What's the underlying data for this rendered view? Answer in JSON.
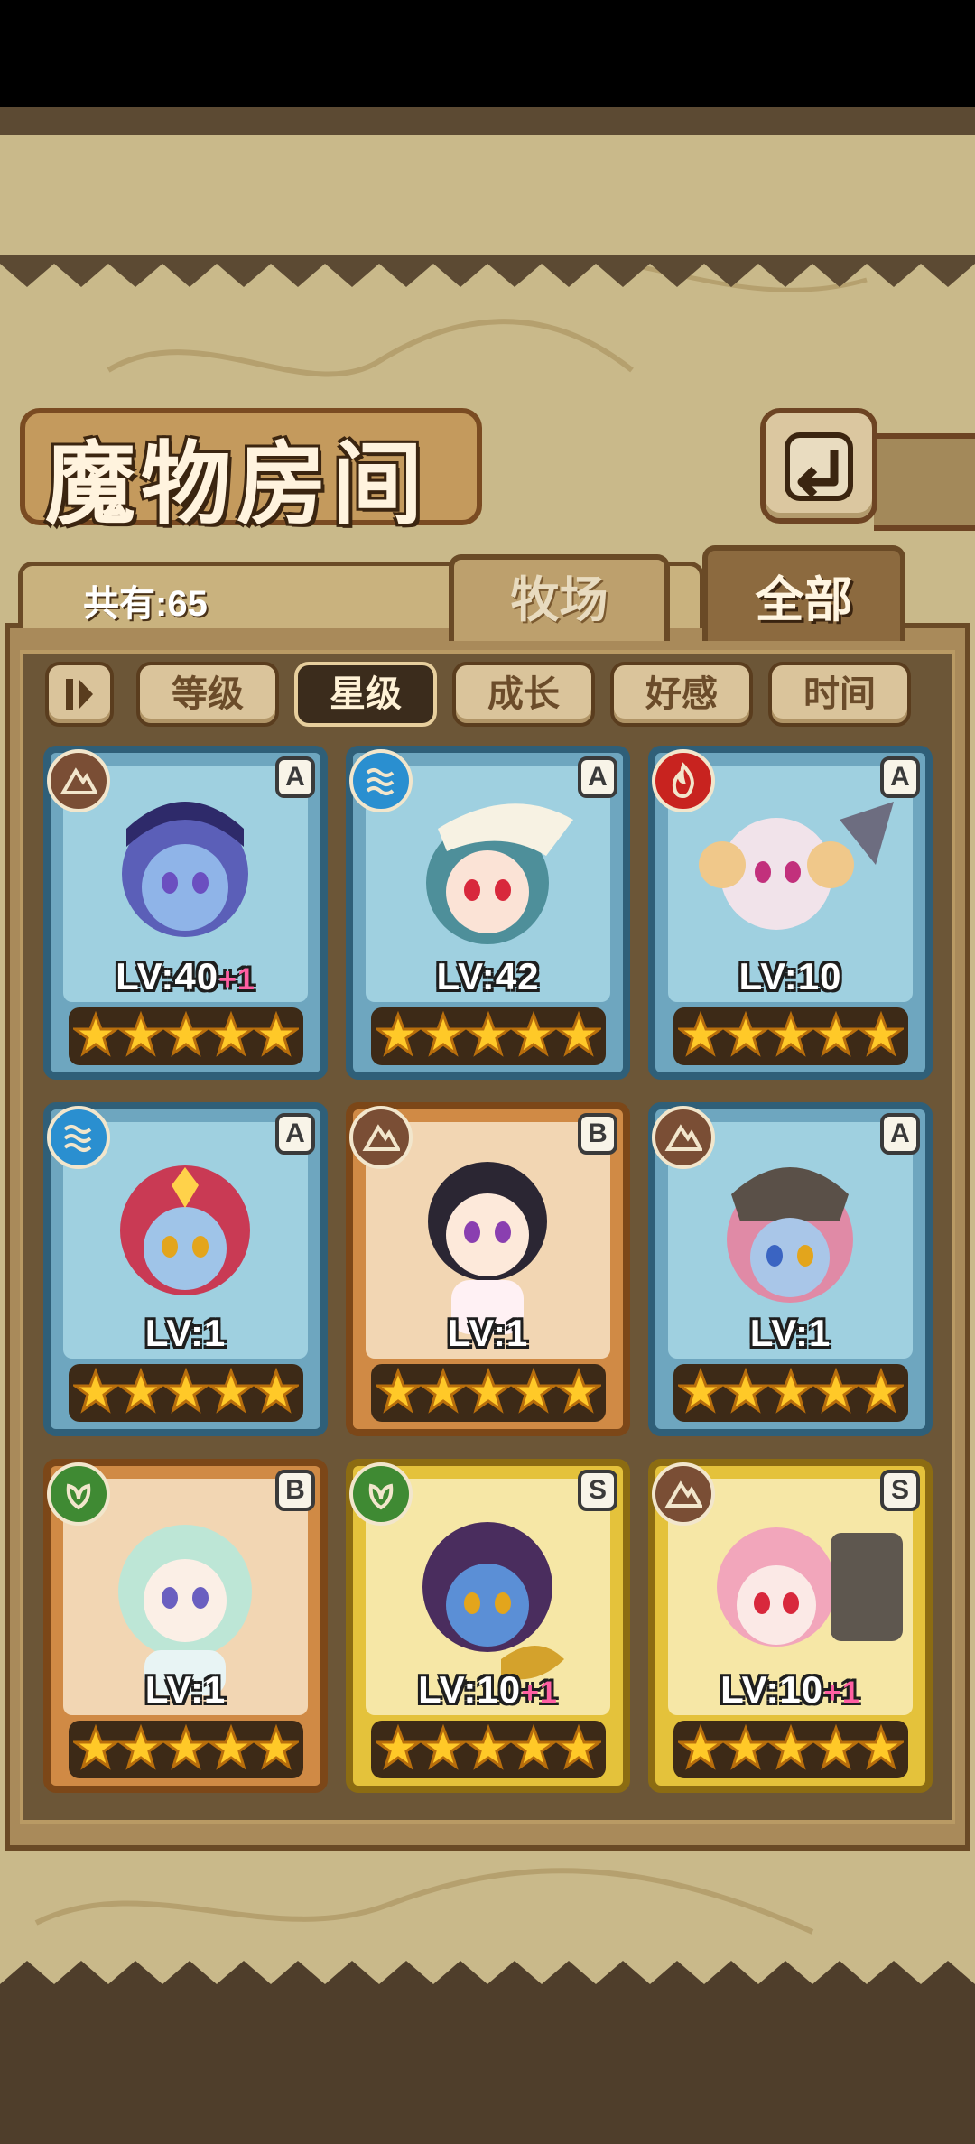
{
  "header": {
    "title": "魔物房间"
  },
  "summary": {
    "count_label": "共有:65"
  },
  "tabs": [
    {
      "label": "牧场",
      "active": false
    },
    {
      "label": "全部",
      "active": true
    }
  ],
  "sort_buttons": [
    {
      "label": "等级",
      "active": false
    },
    {
      "label": "星级",
      "active": true
    },
    {
      "label": "成长",
      "active": false
    },
    {
      "label": "好感",
      "active": false
    },
    {
      "label": "时间",
      "active": false
    }
  ],
  "monsters": [
    {
      "element": "earth",
      "rank": "A",
      "frame": "blue",
      "level": "LV:40",
      "bonus": "+1",
      "stars": 5
    },
    {
      "element": "water",
      "rank": "A",
      "frame": "blue",
      "level": "LV:42",
      "bonus": "",
      "stars": 5
    },
    {
      "element": "fire",
      "rank": "A",
      "frame": "blue",
      "level": "LV:10",
      "bonus": "",
      "stars": 5
    },
    {
      "element": "water",
      "rank": "A",
      "frame": "blue",
      "level": "LV:1",
      "bonus": "",
      "stars": 5
    },
    {
      "element": "earth",
      "rank": "B",
      "frame": "orange",
      "level": "LV:1",
      "bonus": "",
      "stars": 5
    },
    {
      "element": "earth",
      "rank": "A",
      "frame": "blue",
      "level": "LV:1",
      "bonus": "",
      "stars": 5
    },
    {
      "element": "wood",
      "rank": "B",
      "frame": "orange",
      "level": "LV:1",
      "bonus": "",
      "stars": 5
    },
    {
      "element": "wood",
      "rank": "S",
      "frame": "gold",
      "level": "LV:10",
      "bonus": "+1",
      "stars": 5
    },
    {
      "element": "earth",
      "rank": "S",
      "frame": "gold",
      "level": "LV:10",
      "bonus": "+1",
      "stars": 5
    }
  ],
  "colors": {
    "background_map": "#c9b98a",
    "panel": "#6c5637",
    "frame_blue": "#2f5f78",
    "frame_orange": "#7c4718",
    "frame_gold": "#8c6c12",
    "bonus_pink": "#ff5fa2",
    "star": "#ffc928"
  }
}
